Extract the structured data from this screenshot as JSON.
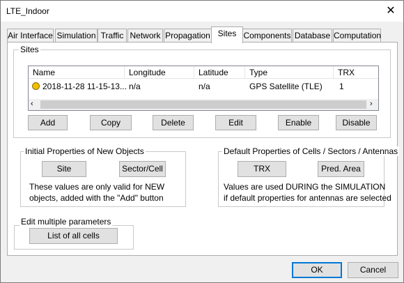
{
  "window": {
    "title": "LTE_Indoor"
  },
  "tabs": [
    {
      "label": "Air Interface"
    },
    {
      "label": "Simulation"
    },
    {
      "label": "Traffic"
    },
    {
      "label": "Network"
    },
    {
      "label": "Propagation"
    },
    {
      "label": "Sites",
      "active": true
    },
    {
      "label": "Components"
    },
    {
      "label": "Database"
    },
    {
      "label": "Computation"
    }
  ],
  "sites_group": {
    "title": "Sites",
    "columns": [
      "Name",
      "Longitude",
      "Latitude",
      "Type",
      "TRX"
    ],
    "rows": [
      {
        "name": "2018-11-28   11-15-13...",
        "longitude": "n/a",
        "latitude": "n/a",
        "type": "GPS Satellite (TLE)",
        "trx": "1",
        "status_color": "#f0c000"
      }
    ],
    "buttons": {
      "add": "Add",
      "copy": "Copy",
      "delete": "Delete",
      "edit": "Edit",
      "enable": "Enable",
      "disable": "Disable"
    }
  },
  "initial_props": {
    "title": "Initial Properties of New Objects",
    "site_button": "Site",
    "sector_button": "Sector/Cell",
    "note_line1": "These values are only valid for    NEW",
    "note_line2": "objects, added with the \"Add\" button"
  },
  "default_props": {
    "title": "Default Properties of Cells / Sectors / Antennas",
    "trx_button": "TRX",
    "pred_button": "Pred. Area",
    "note_line1": "Values are used DURING  the SIMULATION",
    "note_line2": "if default properties for antennas are selected"
  },
  "edit_multiple": {
    "title": "Edit multiple parameters",
    "list_button": "List of all cells"
  },
  "footer": {
    "ok": "OK",
    "cancel": "Cancel"
  },
  "colors": {
    "accent": "#0078d7",
    "panel": "#ffffff",
    "window": "#f0f0f0"
  }
}
